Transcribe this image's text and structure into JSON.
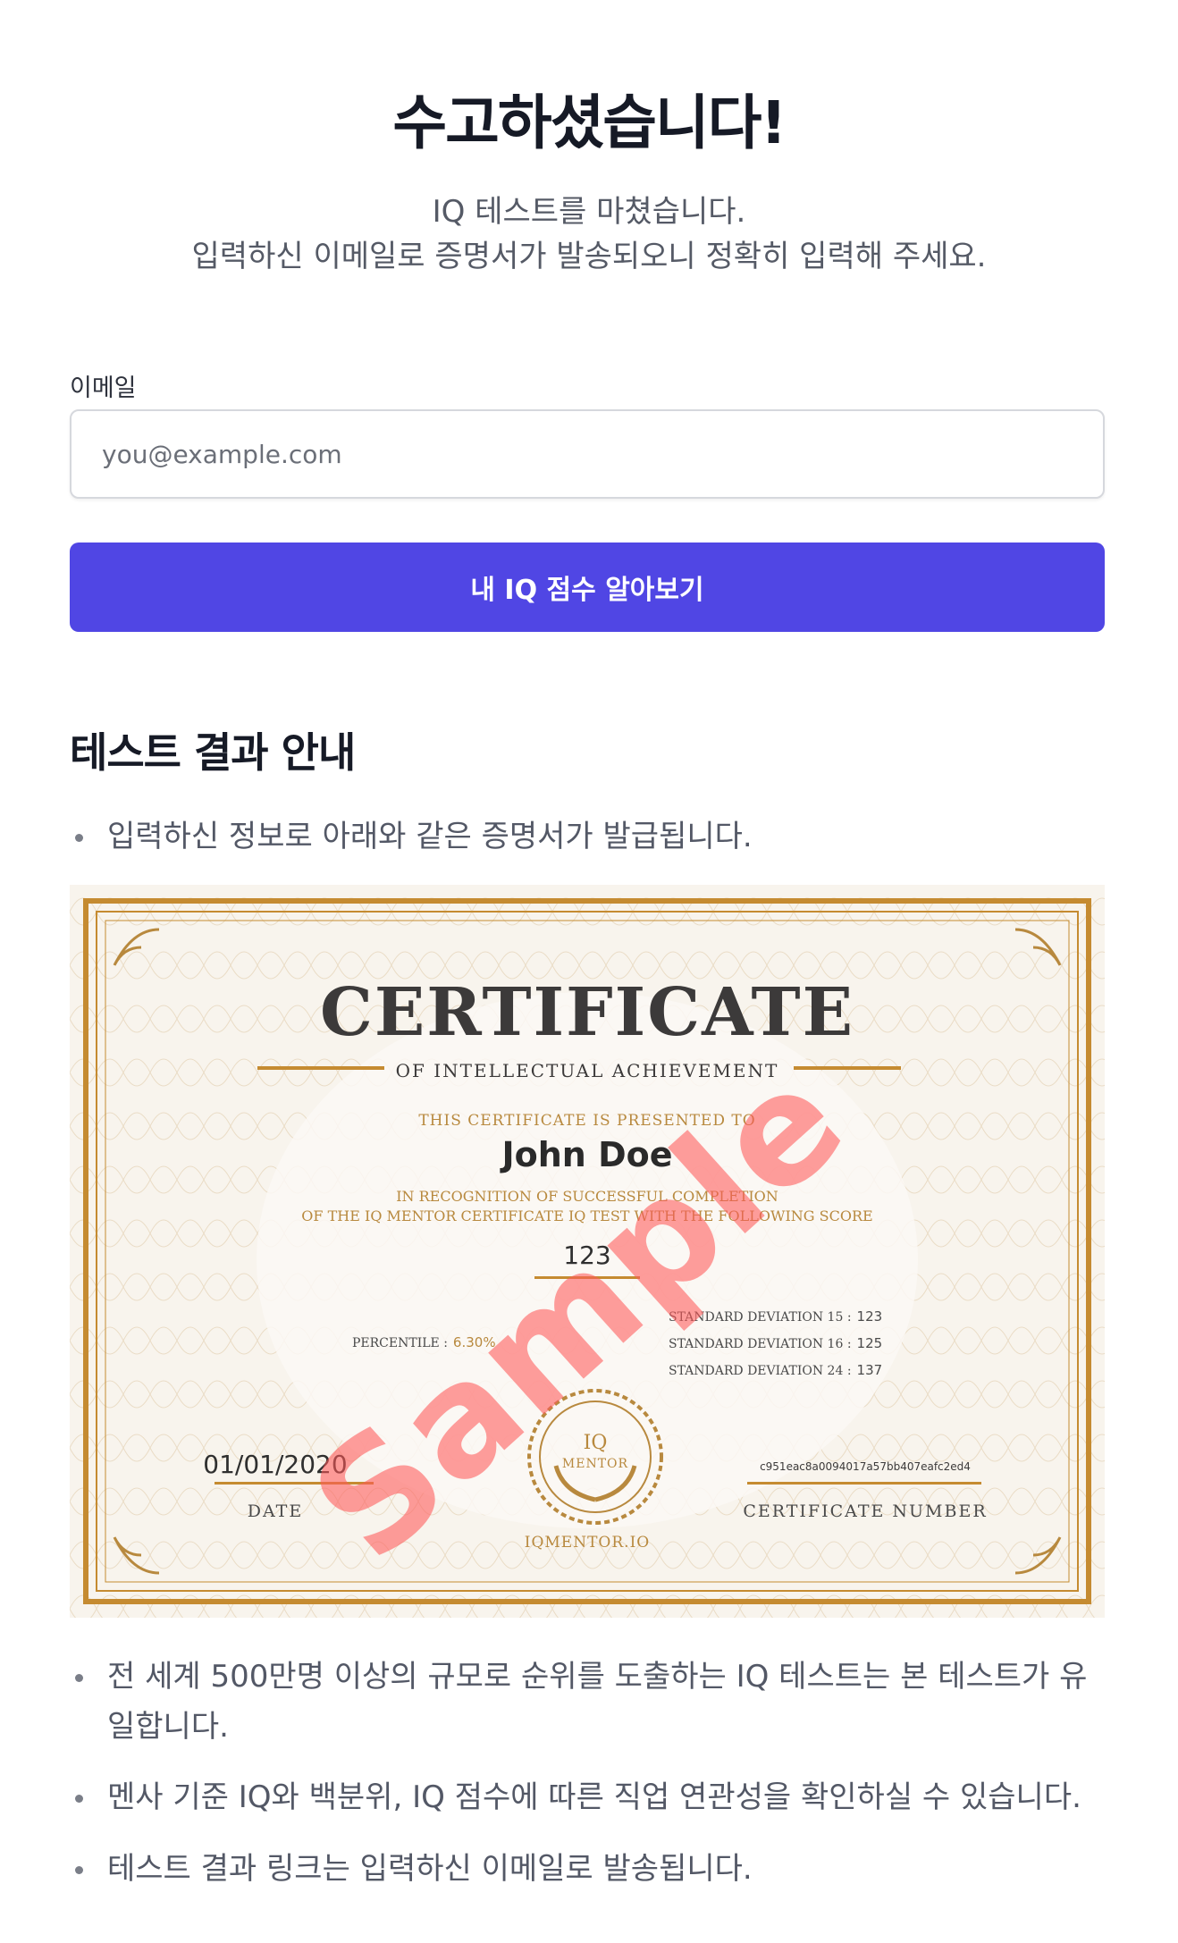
{
  "page": {
    "title": "수고하셨습니다!",
    "subtitle_line1": "IQ 테스트를 마쳤습니다.",
    "subtitle_line2": "입력하신 이메일로 증명서가 발송되오니 정확히 입력해 주세요."
  },
  "form": {
    "email_label": "이메일",
    "email_placeholder": "you@example.com",
    "email_value": "",
    "submit_label": "내 IQ 점수 알아보기"
  },
  "info": {
    "heading": "테스트 결과 안내",
    "bullets": [
      "입력하신 정보로 아래와 같은 증명서가 발급됩니다.",
      "전 세계 500만명 이상의 규모로 순위를 도출하는 IQ 테스트는 본 테스트가 유일합니다.",
      "멘사 기준 IQ와 백분위, IQ 점수에 따른 직업 연관성을 확인하실 수 있습니다.",
      "테스트 결과 링크는 입력하신 이메일로 발송됩니다."
    ]
  },
  "certificate": {
    "title": "CERTIFICATE",
    "subtitle": "OF INTELLECTUAL ACHIEVEMENT",
    "presented_to": "THIS CERTIFICATE IS PRESENTED TO",
    "name": "John Doe",
    "recognition_line1": "IN RECOGNITION OF SUCCESSFUL COMPLETION",
    "recognition_line2": "OF THE IQ MENTOR CERTIFICATE IQ TEST WITH THE FOLLOWING SCORE",
    "score": "123",
    "percentile_label": "PERCENTILE :",
    "percentile_value": "6.30%",
    "sd15_label": "STANDARD DEVIATION 15 :",
    "sd15_value": "123",
    "sd16_label": "STANDARD DEVIATION 16 :",
    "sd16_value": "125",
    "sd24_label": "STANDARD DEVIATION 24 :",
    "sd24_value": "137",
    "date": "01/01/2020",
    "date_label": "DATE",
    "seal_line1": "IQ",
    "seal_line2": "MENTOR",
    "cert_number": "c951eac8a0094017a57bb407eafc2ed4",
    "cert_number_label": "CERTIFICATE NUMBER",
    "url": "IQMENTOR.IO",
    "watermark": "Sample"
  },
  "colors": {
    "primary_button": "#5046e4",
    "gold": "#c58b31",
    "watermark": "#ff5a5a"
  }
}
